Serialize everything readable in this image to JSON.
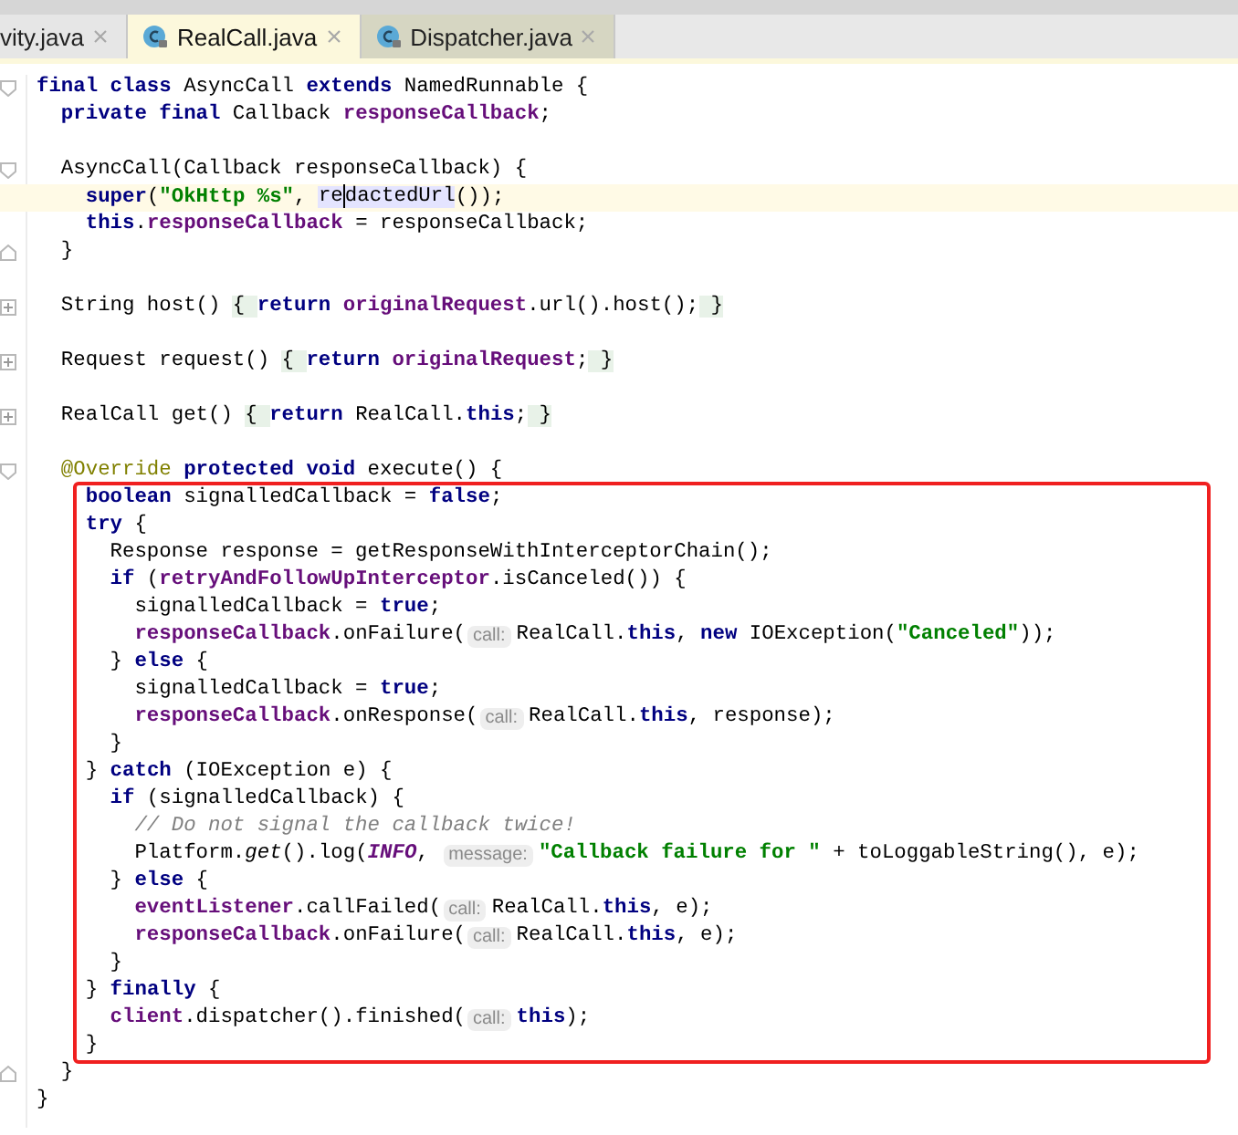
{
  "tabs": [
    {
      "label": "vity.java",
      "selected": false,
      "kind": "cut",
      "color": "#e6e6e6"
    },
    {
      "label": "RealCall.java",
      "selected": true,
      "kind": "class",
      "color": "#fcf8dc"
    },
    {
      "label": "Dispatcher.java",
      "selected": false,
      "kind": "class",
      "color": "#d6d6c2"
    }
  ],
  "lines": [
    {
      "kind": "code",
      "fold_start": true,
      "tokens": [
        {
          "kind": "keyword",
          "text": "final class"
        },
        {
          "kind": "plain",
          "text": " AsyncCall "
        },
        {
          "kind": "keyword",
          "text": "extends"
        },
        {
          "kind": "plain",
          "text": " NamedRunnable {"
        }
      ]
    },
    {
      "kind": "code",
      "tokens": [
        {
          "kind": "keyword",
          "text": "  private final"
        },
        {
          "kind": "plain",
          "text": " Callback "
        },
        {
          "kind": "field",
          "text": "responseCallback"
        },
        {
          "kind": "plain",
          "text": ";"
        }
      ]
    },
    {
      "kind": "blank"
    },
    {
      "kind": "code",
      "fold_start": true,
      "tokens": [
        {
          "kind": "plain",
          "text": "  AsyncCall(Callback responseCallback) {"
        }
      ]
    },
    {
      "kind": "code",
      "current": true,
      "tokens": [
        {
          "kind": "keyword",
          "text": "    super"
        },
        {
          "kind": "plain",
          "text": "("
        },
        {
          "kind": "string",
          "text": "\"OkHttp %s\""
        },
        {
          "kind": "plain",
          "text": ", "
        },
        {
          "kind": "usage",
          "text": "re"
        },
        {
          "kind": "caret"
        },
        {
          "kind": "usage",
          "text": "dactedUrl"
        },
        {
          "kind": "plain",
          "text": "());"
        }
      ]
    },
    {
      "kind": "code",
      "tokens": [
        {
          "kind": "keyword",
          "text": "    this"
        },
        {
          "kind": "plain",
          "text": "."
        },
        {
          "kind": "field",
          "text": "responseCallback"
        },
        {
          "kind": "plain",
          "text": " = responseCallback;"
        }
      ]
    },
    {
      "kind": "code",
      "fold_end": true,
      "tokens": [
        {
          "kind": "plain",
          "text": "  }"
        }
      ]
    },
    {
      "kind": "blank"
    },
    {
      "kind": "code",
      "collapsed": true,
      "tokens": [
        {
          "kind": "plain",
          "text": "  String host() "
        },
        {
          "kind": "fold",
          "text": "{ "
        },
        {
          "kind": "keyword",
          "text": "return "
        },
        {
          "kind": "field",
          "text": "originalRequest"
        },
        {
          "kind": "plain",
          "text": ".url().host();"
        },
        {
          "kind": "fold",
          "text": " }"
        }
      ]
    },
    {
      "kind": "blank"
    },
    {
      "kind": "code",
      "collapsed": true,
      "tokens": [
        {
          "kind": "plain",
          "text": "  Request request() "
        },
        {
          "kind": "fold",
          "text": "{ "
        },
        {
          "kind": "keyword",
          "text": "return "
        },
        {
          "kind": "field",
          "text": "originalRequest"
        },
        {
          "kind": "plain",
          "text": ";"
        },
        {
          "kind": "fold",
          "text": " }"
        }
      ]
    },
    {
      "kind": "blank"
    },
    {
      "kind": "code",
      "collapsed": true,
      "tokens": [
        {
          "kind": "plain",
          "text": "  RealCall get() "
        },
        {
          "kind": "fold",
          "text": "{ "
        },
        {
          "kind": "keyword",
          "text": "return"
        },
        {
          "kind": "plain",
          "text": " RealCall."
        },
        {
          "kind": "keyword",
          "text": "this"
        },
        {
          "kind": "plain",
          "text": ";"
        },
        {
          "kind": "fold",
          "text": " }"
        }
      ]
    },
    {
      "kind": "blank"
    },
    {
      "kind": "code",
      "fold_start": true,
      "tokens": [
        {
          "kind": "annotation",
          "text": "  @Override"
        },
        {
          "kind": "keyword",
          "text": " protected void"
        },
        {
          "kind": "plain",
          "text": " execute() {"
        }
      ]
    },
    {
      "kind": "code",
      "tokens": [
        {
          "kind": "keyword",
          "text": "    boolean"
        },
        {
          "kind": "plain",
          "text": " signalledCallback = "
        },
        {
          "kind": "keyword",
          "text": "false"
        },
        {
          "kind": "plain",
          "text": ";"
        }
      ]
    },
    {
      "kind": "code",
      "tokens": [
        {
          "kind": "keyword",
          "text": "    try"
        },
        {
          "kind": "plain",
          "text": " {"
        }
      ]
    },
    {
      "kind": "code",
      "tokens": [
        {
          "kind": "plain",
          "text": "      Response response = getResponseWithInterceptorChain();"
        }
      ]
    },
    {
      "kind": "code",
      "tokens": [
        {
          "kind": "keyword",
          "text": "      if"
        },
        {
          "kind": "plain",
          "text": " ("
        },
        {
          "kind": "field",
          "text": "retryAndFollowUpInterceptor"
        },
        {
          "kind": "plain",
          "text": ".isCanceled()) {"
        }
      ]
    },
    {
      "kind": "code",
      "tokens": [
        {
          "kind": "plain",
          "text": "        signalledCallback = "
        },
        {
          "kind": "keyword",
          "text": "true"
        },
        {
          "kind": "plain",
          "text": ";"
        }
      ]
    },
    {
      "kind": "code",
      "tokens": [
        {
          "kind": "field",
          "text": "        responseCallback"
        },
        {
          "kind": "plain",
          "text": ".onFailure("
        },
        {
          "kind": "hint",
          "text": "call:"
        },
        {
          "kind": "plain",
          "text": "RealCall."
        },
        {
          "kind": "keyword",
          "text": "this"
        },
        {
          "kind": "plain",
          "text": ", "
        },
        {
          "kind": "keyword",
          "text": "new"
        },
        {
          "kind": "plain",
          "text": " IOException("
        },
        {
          "kind": "string",
          "text": "\"Canceled\""
        },
        {
          "kind": "plain",
          "text": "));"
        }
      ]
    },
    {
      "kind": "code",
      "tokens": [
        {
          "kind": "plain",
          "text": "      } "
        },
        {
          "kind": "keyword",
          "text": "else"
        },
        {
          "kind": "plain",
          "text": " {"
        }
      ]
    },
    {
      "kind": "code",
      "tokens": [
        {
          "kind": "plain",
          "text": "        signalledCallback = "
        },
        {
          "kind": "keyword",
          "text": "true"
        },
        {
          "kind": "plain",
          "text": ";"
        }
      ]
    },
    {
      "kind": "code",
      "tokens": [
        {
          "kind": "field",
          "text": "        responseCallback"
        },
        {
          "kind": "plain",
          "text": ".onResponse("
        },
        {
          "kind": "hint",
          "text": "call:"
        },
        {
          "kind": "plain",
          "text": "RealCall."
        },
        {
          "kind": "keyword",
          "text": "this"
        },
        {
          "kind": "plain",
          "text": ", response);"
        }
      ]
    },
    {
      "kind": "code",
      "tokens": [
        {
          "kind": "plain",
          "text": "      }"
        }
      ]
    },
    {
      "kind": "code",
      "tokens": [
        {
          "kind": "plain",
          "text": "    } "
        },
        {
          "kind": "keyword",
          "text": "catch"
        },
        {
          "kind": "plain",
          "text": " (IOException e) {"
        }
      ]
    },
    {
      "kind": "code",
      "tokens": [
        {
          "kind": "keyword",
          "text": "      if"
        },
        {
          "kind": "plain",
          "text": " (signalledCallback) {"
        }
      ]
    },
    {
      "kind": "code",
      "tokens": [
        {
          "kind": "comment",
          "text": "        // Do not signal the callback twice!"
        }
      ]
    },
    {
      "kind": "code",
      "tokens": [
        {
          "kind": "plain",
          "text": "        Platform."
        },
        {
          "kind": "italic",
          "text": "get"
        },
        {
          "kind": "plain",
          "text": "().log("
        },
        {
          "kind": "static",
          "text": "INFO"
        },
        {
          "kind": "plain",
          "text": ", "
        },
        {
          "kind": "hint",
          "text": "message:"
        },
        {
          "kind": "string",
          "text": "\"Callback failure for \""
        },
        {
          "kind": "plain",
          "text": " + toLoggableString(), e);"
        }
      ]
    },
    {
      "kind": "code",
      "tokens": [
        {
          "kind": "plain",
          "text": "      } "
        },
        {
          "kind": "keyword",
          "text": "else"
        },
        {
          "kind": "plain",
          "text": " {"
        }
      ]
    },
    {
      "kind": "code",
      "tokens": [
        {
          "kind": "field",
          "text": "        eventListener"
        },
        {
          "kind": "plain",
          "text": ".callFailed("
        },
        {
          "kind": "hint",
          "text": "call:"
        },
        {
          "kind": "plain",
          "text": "RealCall."
        },
        {
          "kind": "keyword",
          "text": "this"
        },
        {
          "kind": "plain",
          "text": ", e);"
        }
      ]
    },
    {
      "kind": "code",
      "tokens": [
        {
          "kind": "field",
          "text": "        responseCallback"
        },
        {
          "kind": "plain",
          "text": ".onFailure("
        },
        {
          "kind": "hint",
          "text": "call:"
        },
        {
          "kind": "plain",
          "text": "RealCall."
        },
        {
          "kind": "keyword",
          "text": "this"
        },
        {
          "kind": "plain",
          "text": ", e);"
        }
      ]
    },
    {
      "kind": "code",
      "tokens": [
        {
          "kind": "plain",
          "text": "      }"
        }
      ]
    },
    {
      "kind": "code",
      "tokens": [
        {
          "kind": "plain",
          "text": "    } "
        },
        {
          "kind": "keyword",
          "text": "finally"
        },
        {
          "kind": "plain",
          "text": " {"
        }
      ]
    },
    {
      "kind": "code",
      "tokens": [
        {
          "kind": "field",
          "text": "      client"
        },
        {
          "kind": "plain",
          "text": ".dispatcher().finished("
        },
        {
          "kind": "hint",
          "text": "call:"
        },
        {
          "kind": "keyword",
          "text": "this"
        },
        {
          "kind": "plain",
          "text": ");"
        }
      ]
    },
    {
      "kind": "code",
      "tokens": [
        {
          "kind": "plain",
          "text": "    }"
        }
      ]
    },
    {
      "kind": "code",
      "fold_end": true,
      "tokens": [
        {
          "kind": "plain",
          "text": "  }"
        }
      ]
    },
    {
      "kind": "code",
      "tokens": [
        {
          "kind": "plain",
          "text": "}"
        }
      ]
    }
  ]
}
